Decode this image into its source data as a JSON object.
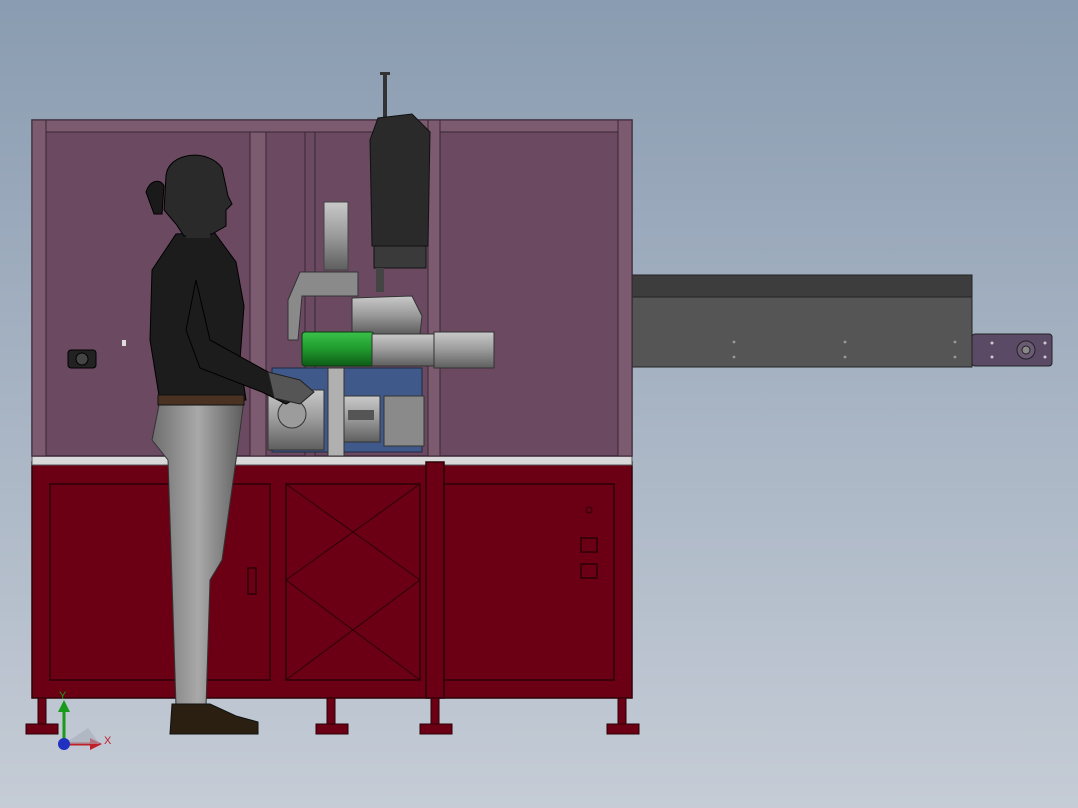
{
  "viewport": {
    "background_top": "#8a9cb1",
    "background_bottom": "#c5ccd6"
  },
  "colors": {
    "upper_panel": "#6b4a61",
    "upper_frame": "#7c5a70",
    "lower_cabinet": "#6b0014",
    "lower_cabinet_line": "#2c0008",
    "conveyor": "#555555",
    "conveyor_top": "#3d3d3d",
    "motor_green": "#1f9a2d",
    "motor_gray": "#9a9a9a",
    "machine_blue": "#3f5a8a",
    "figure_skin": "#2a2a2a",
    "figure_shirt": "#1c1c1c",
    "figure_pants": "#8c8c8c",
    "shoe": "#2b1f12"
  },
  "triad": {
    "y_label": "Y",
    "x_label": "X",
    "y_color": "#1a9a1a",
    "x_color": "#c0202a",
    "z_color": "#2030c0"
  },
  "objects": {
    "machine": "machine-assembly",
    "operator": "operator-figure",
    "conveyor": "conveyor-belt"
  }
}
